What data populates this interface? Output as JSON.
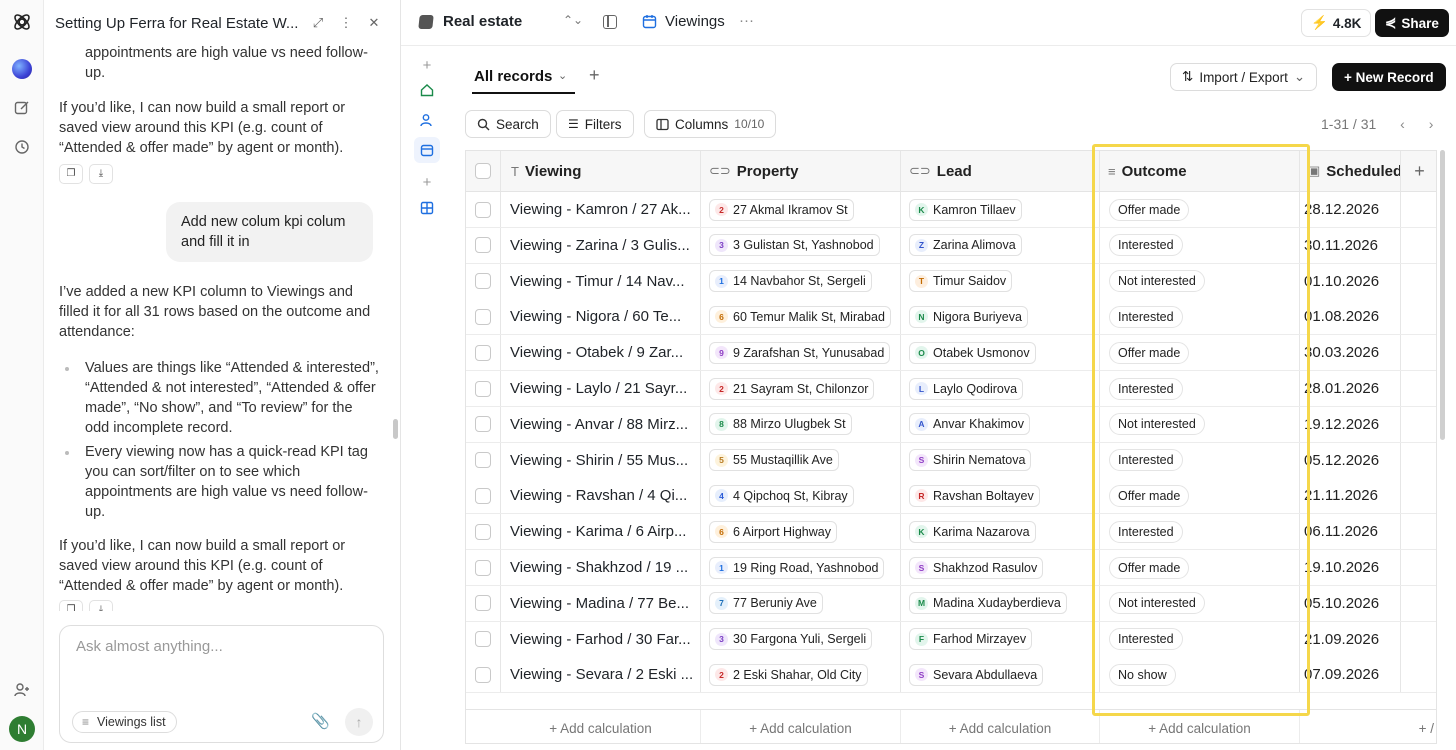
{
  "chat": {
    "title": "Setting Up Ferra for Real Estate W...",
    "top_partial": "appointments are high value vs need follow-up.",
    "offer_para": "If you’d like, I can now build a small report or saved view around this KPI (e.g. count of “Attended & offer made” by agent or month).",
    "user_msg": "Add new colum kpi colum and fill it in",
    "reply_para": "I’ve added a new KPI column to Viewings and filled it for all 31 rows based on the outcome and attendance:",
    "bullet1": "Values are things like “Attended & interested”, “Attended & not interested”, “Attended & offer made”, “No show”, and “To review” for the odd incomplete record.",
    "bullet2": "Every viewing now has a quick-read KPI tag you can sort/filter on to see which appointments are high value vs need follow-up.",
    "offer_para2": "If you’d like, I can now build a small report or saved view around this KPI (e.g. count of “Attended & offer made” by agent or month).",
    "composer_placeholder": "Ask almost anything...",
    "context_chip": "Viewings list"
  },
  "topbar": {
    "workspace": "Real estate",
    "view_title": "Viewings",
    "credits": "4.8K",
    "share_label": "Share"
  },
  "toolbar": {
    "tab_label": "All records",
    "import_export": "Import / Export",
    "new_record": "+ New Record",
    "search": "Search",
    "filters": "Filters",
    "columns": "Columns",
    "columns_count": "10/10",
    "pager": "1-31 / 31"
  },
  "table": {
    "columns": [
      "Viewing",
      "Property",
      "Lead",
      "Outcome",
      "Scheduled"
    ],
    "rows": [
      {
        "viewing": "Viewing - Kamron / 27 Ak...",
        "pn": "2",
        "property": "27 Akmal Ikramov St",
        "li": "K",
        "lead": "Kamron Tillaev",
        "outcome": "Offer made",
        "date": "28.12.2026"
      },
      {
        "viewing": "Viewing - Zarina / 3 Gulis...",
        "pn": "3",
        "property": "3 Gulistan St, Yashnobod",
        "li": "Z",
        "lead": "Zarina Alimova",
        "outcome": "Interested",
        "date": "30.11.2026"
      },
      {
        "viewing": "Viewing - Timur / 14 Nav...",
        "pn": "1",
        "property": "14 Navbahor St, Sergeli",
        "li": "T",
        "lead": "Timur Saidov",
        "outcome": "Not interested",
        "date": "01.10.2026"
      },
      {
        "viewing": "Viewing - Nigora / 60 Te...",
        "pn": "6",
        "property": "60 Temur Malik St, Mirabad",
        "li": "N",
        "lead": "Nigora Buriyeva",
        "outcome": "Interested",
        "date": "01.08.2026"
      },
      {
        "viewing": "Viewing - Otabek / 9 Zar...",
        "pn": "9",
        "property": "9 Zarafshan St, Yunusabad",
        "li": "O",
        "lead": "Otabek Usmonov",
        "outcome": "Offer made",
        "date": "30.03.2026"
      },
      {
        "viewing": "Viewing - Laylo / 21 Sayr...",
        "pn": "2",
        "property": "21 Sayram St, Chilonzor",
        "li": "L",
        "lead": "Laylo Qodirova",
        "outcome": "Interested",
        "date": "28.01.2026"
      },
      {
        "viewing": "Viewing - Anvar / 88 Mirz...",
        "pn": "8",
        "property": "88 Mirzo Ulugbek St",
        "li": "A",
        "lead": "Anvar Khakimov",
        "outcome": "Not interested",
        "date": "19.12.2026"
      },
      {
        "viewing": "Viewing - Shirin / 55 Mus...",
        "pn": "5",
        "property": "55 Mustaqillik Ave",
        "li": "S",
        "lead": "Shirin Nematova",
        "outcome": "Interested",
        "date": "05.12.2026"
      },
      {
        "viewing": "Viewing - Ravshan / 4 Qi...",
        "pn": "4",
        "property": "4 Qipchoq St, Kibray",
        "li": "R",
        "lead": "Ravshan Boltayev",
        "outcome": "Offer made",
        "date": "21.11.2026"
      },
      {
        "viewing": "Viewing - Karima / 6 Airp...",
        "pn": "6",
        "property": "6 Airport Highway",
        "li": "K",
        "lead": "Karima Nazarova",
        "outcome": "Interested",
        "date": "06.11.2026"
      },
      {
        "viewing": "Viewing - Shakhzod / 19 ...",
        "pn": "1",
        "property": "19 Ring Road, Yashnobod",
        "li": "S",
        "lead": "Shakhzod Rasulov",
        "outcome": "Offer made",
        "date": "19.10.2026"
      },
      {
        "viewing": "Viewing - Madina / 77 Be...",
        "pn": "7",
        "property": "77 Beruniy Ave",
        "li": "M",
        "lead": "Madina Xudayberdieva",
        "outcome": "Not interested",
        "date": "05.10.2026"
      },
      {
        "viewing": "Viewing - Farhod / 30 Far...",
        "pn": "3",
        "property": "30 Fargona Yuli, Sergeli",
        "li": "F",
        "lead": "Farhod Mirzayev",
        "outcome": "Interested",
        "date": "21.09.2026"
      },
      {
        "viewing": "Viewing - Sevara / 2 Eski ...",
        "pn": "2",
        "property": "2 Eski Shahar, Old City",
        "li": "S",
        "lead": "Sevara Abdullaeva",
        "outcome": "No show",
        "date": "07.09.2026"
      }
    ],
    "add_calc": "+ Add calculation"
  },
  "colors": {
    "highlight": "#f5d74a",
    "accent": "#1e6fe0"
  }
}
